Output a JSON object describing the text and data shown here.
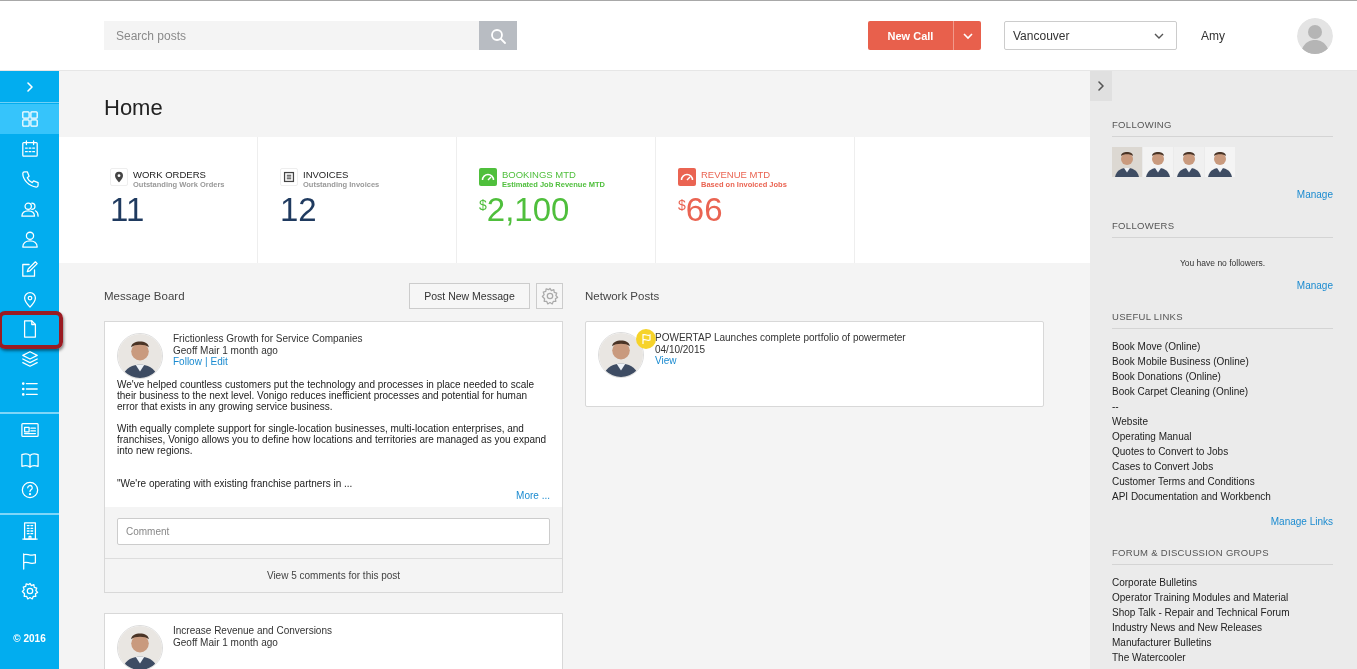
{
  "header": {
    "search": {
      "placeholder": "Search posts"
    },
    "new_call": "New Call",
    "location": "Vancouver",
    "user": "Amy"
  },
  "sidebar": {
    "groups": [
      {
        "items": [
          {
            "selected": true,
            "highlighted": false
          },
          {
            "selected": false,
            "highlighted": false
          },
          {
            "selected": false,
            "highlighted": false
          },
          {
            "selected": false,
            "highlighted": false
          },
          {
            "selected": false,
            "highlighted": false
          },
          {
            "selected": false,
            "highlighted": false
          },
          {
            "selected": false,
            "highlighted": false
          },
          {
            "selected": false,
            "highlighted": true
          },
          {
            "selected": false,
            "highlighted": false
          },
          {
            "selected": false,
            "highlighted": false
          }
        ]
      },
      {
        "items": [
          {
            "selected": false,
            "highlighted": false
          },
          {
            "selected": false,
            "highlighted": false
          },
          {
            "selected": false,
            "highlighted": false
          }
        ]
      },
      {
        "items": [
          {
            "selected": false,
            "highlighted": false
          },
          {
            "selected": false,
            "highlighted": false
          },
          {
            "selected": false,
            "highlighted": false
          }
        ]
      }
    ],
    "copyright": "© 2016"
  },
  "page_title": "Home",
  "stats": [
    {
      "kind": "count",
      "title": "WORK ORDERS",
      "subtitle": "Outstanding Work Orders",
      "value": "11"
    },
    {
      "kind": "count",
      "title": "INVOICES",
      "subtitle": "Outstanding Invoices",
      "value": "12"
    },
    {
      "kind": "money",
      "color": "#4fbf3c",
      "title": "BOOKINGS MTD",
      "subtitle": "Estimated Job Revenue MTD",
      "currency": "$",
      "value": "2,100"
    },
    {
      "kind": "money",
      "color": "#ea6452",
      "title": "REVENUE MTD",
      "subtitle": "Based on Invoiced Jobs",
      "currency": "$",
      "value": "66"
    }
  ],
  "message_board": {
    "title": "Message Board",
    "post_button": "Post New Message",
    "posts": [
      {
        "title": "Frictionless Growth for Service Companies",
        "byline": "Geoff Mair 1 month ago",
        "actions": [
          "Follow",
          "Edit"
        ],
        "separator": "|",
        "paragraphs": [
          "We've helped countless customers put the technology and processes in place needed to scale their business to the next level. Vonigo reduces inefficient processes and potential for human error that exists in any growing service business.",
          "With equally complete support for single-location businesses, multi-location enterprises, and franchises, Vonigo allows you to define how locations and territories are managed as you expand into new regions."
        ],
        "excerpt": "\"We're operating with existing franchise partners in ...",
        "more": "More ...",
        "comment": {
          "placeholder": "Comment"
        },
        "view_comments": "View 5 comments for this post"
      },
      {
        "title": "Increase Revenue and Conversions",
        "byline": "Geoff Mair 1 month ago"
      }
    ]
  },
  "network_posts": {
    "title": "Network Posts",
    "posts": [
      {
        "title": "POWERTAP Launches complete portfolio of powermeter",
        "date": "04/10/2015",
        "action": "View",
        "flagged": true
      }
    ]
  },
  "right_panel": {
    "following": {
      "title": "FOLLOWING",
      "manage": "Manage"
    },
    "followers": {
      "title": "FOLLOWERS",
      "empty": "You have no followers.",
      "manage": "Manage"
    },
    "useful_links": {
      "title": "USEFUL LINKS",
      "links": [
        "Book Move (Online)",
        "Book Mobile Business (Online)",
        "Book Donations (Online)",
        "Book Carpet Cleaning (Online)",
        "--",
        "Website",
        "Operating Manual",
        "Quotes to Convert to Jobs",
        "Cases to Convert Jobs",
        "Customer Terms and Conditions",
        "API Documentation and Workbench"
      ],
      "manage": "Manage Links"
    },
    "forums": {
      "title": "FORUM & DISCUSSION GROUPS",
      "links": [
        "Corporate Bulletins",
        "Operator Training Modules and Material",
        "Shop Talk - Repair and Technical Forum",
        "Industry News and New Releases",
        "Manufacturer Bulletins",
        "The Watercooler"
      ]
    }
  }
}
